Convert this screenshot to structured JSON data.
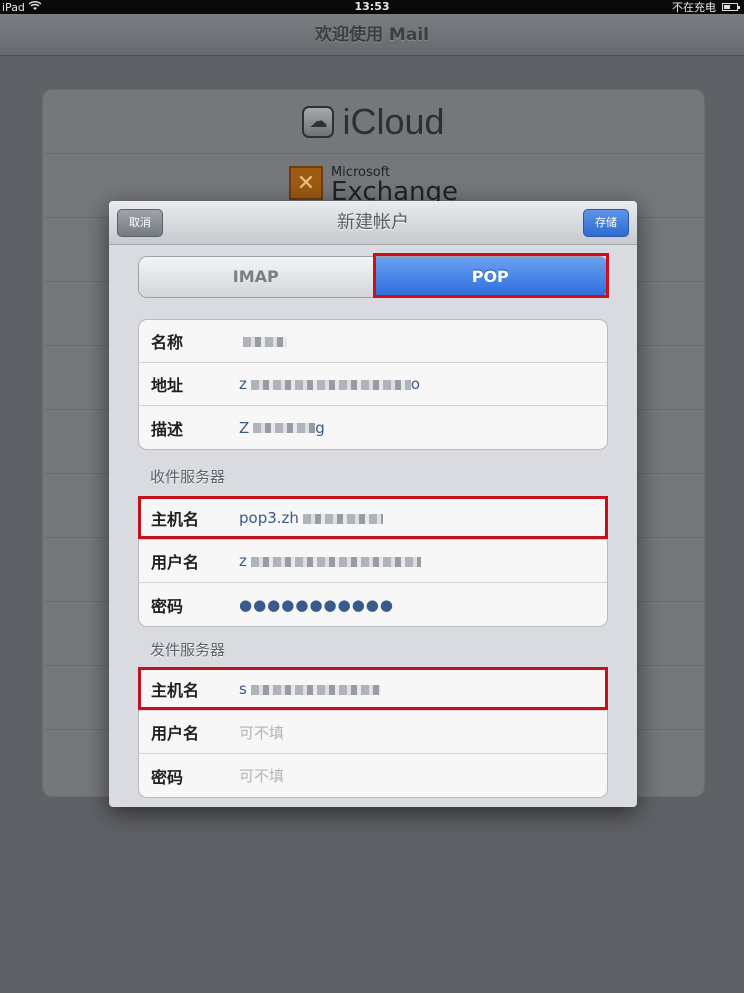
{
  "status_bar": {
    "device": "iPad",
    "time": "13:53",
    "charging": "不在充电"
  },
  "background": {
    "nav_title": "欢迎使用 Mail",
    "providers": [
      {
        "name": "iCloud"
      },
      {
        "name_top": "Microsoft",
        "name_bottom": "Exchange"
      }
    ]
  },
  "modal": {
    "title": "新建帐户",
    "cancel_label": "取消",
    "save_label": "存储",
    "segments": [
      "IMAP",
      "POP"
    ],
    "selected_segment": "POP",
    "account": [
      {
        "label": "名称",
        "value": ""
      },
      {
        "label": "地址",
        "value": "z",
        "value_end": "o"
      },
      {
        "label": "描述",
        "value": "Z",
        "value_end": "g"
      }
    ],
    "incoming": {
      "header": "收件服务器",
      "host_label": "主机名",
      "host_value": "pop3.zh",
      "username_label": "用户名",
      "username_value": "z",
      "password_label": "密码",
      "password_value": "●●●●●●●●●●●"
    },
    "outgoing": {
      "header": "发件服务器",
      "host_label": "主机名",
      "host_value": "s",
      "username_label": "用户名",
      "username_placeholder": "可不填",
      "password_label": "密码",
      "password_placeholder": "可不填"
    }
  },
  "colors": {
    "highlight": "#d10d1a",
    "accent_blue": "#2c6bdc"
  }
}
